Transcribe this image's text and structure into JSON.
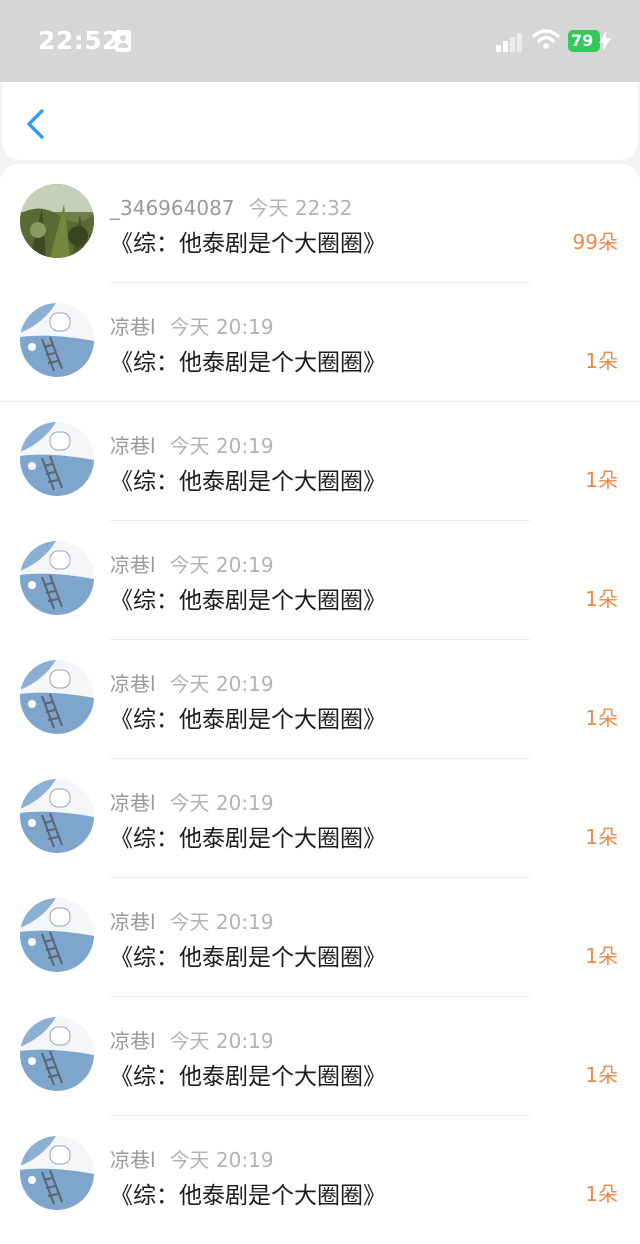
{
  "status_bar": {
    "time": "22:52",
    "battery": "79",
    "signal_icon": "cellular-signal-icon",
    "wifi_icon": "wifi-icon",
    "battery_icon": "battery-charging-icon"
  },
  "nav": {
    "back_icon": "chevron-left-icon"
  },
  "colors": {
    "accent": "#2f9bf0",
    "amount": "#ea8a4a",
    "battery": "#34c759"
  },
  "rows": [
    {
      "name": "_346964087",
      "time": "今天 22:32",
      "title": "《综：他泰剧是个大圈圈》",
      "amount": "99朵"
    },
    {
      "name": "凉巷l",
      "time": "今天 20:19",
      "title": "《综：他泰剧是个大圈圈》",
      "amount": "1朵"
    },
    {
      "name": "凉巷l",
      "time": "今天 20:19",
      "title": "《综：他泰剧是个大圈圈》",
      "amount": "1朵"
    },
    {
      "name": "凉巷l",
      "time": "今天 20:19",
      "title": "《综：他泰剧是个大圈圈》",
      "amount": "1朵"
    },
    {
      "name": "凉巷l",
      "time": "今天 20:19",
      "title": "《综：他泰剧是个大圈圈》",
      "amount": "1朵"
    },
    {
      "name": "凉巷l",
      "time": "今天 20:19",
      "title": "《综：他泰剧是个大圈圈》",
      "amount": "1朵"
    },
    {
      "name": "凉巷l",
      "time": "今天 20:19",
      "title": "《综：他泰剧是个大圈圈》",
      "amount": "1朵"
    },
    {
      "name": "凉巷l",
      "time": "今天 20:19",
      "title": "《综：他泰剧是个大圈圈》",
      "amount": "1朵"
    },
    {
      "name": "凉巷l",
      "time": "今天 20:19",
      "title": "《综：他泰剧是个大圈圈》",
      "amount": "1朵"
    }
  ]
}
